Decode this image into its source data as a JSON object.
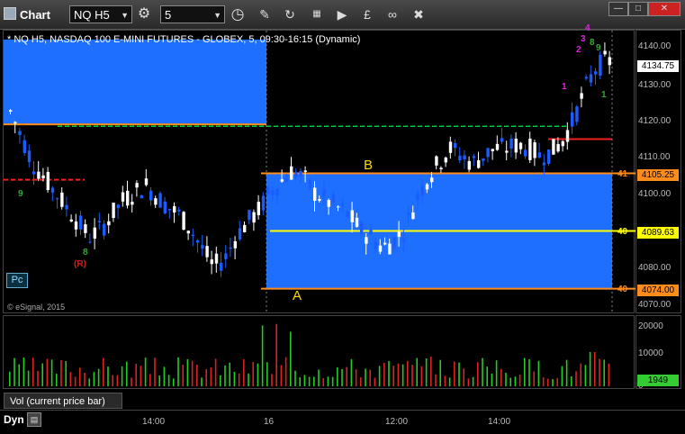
{
  "app": {
    "title": "Chart"
  },
  "toolbar": {
    "symbol": "NQ H5",
    "interval": "5"
  },
  "chart": {
    "header": "* NQ H5, NASDAQ 100 E-MINI FUTURES - GLOBEX, 5, 09:30-16:15 (Dynamic)",
    "watermark": "© eSignal, 2015",
    "pc_label": "Pc",
    "annotations": {
      "a": "A",
      "b": "B"
    },
    "price_ticks": [
      "4140.00",
      "4130.00",
      "4120.00",
      "4110.00",
      "4100.00",
      "4080.00",
      "4070.00"
    ],
    "levels": [
      {
        "value": "4105.25",
        "stub": "41",
        "color": "#ff8c1a"
      },
      {
        "value": "4089.63",
        "stub": "40",
        "color": "#ffff00"
      },
      {
        "value": "4074.00",
        "stub": "40",
        "color": "#ff8c1a"
      }
    ],
    "current_price": "4134.75",
    "volume_ticks": [
      "20000",
      "10000",
      "0"
    ],
    "current_volume": "1949",
    "volume_label": "Vol (current price bar)",
    "time_ticks": [
      "14:00",
      "16",
      "12:00",
      "14:00"
    ],
    "dyn_label": "Dyn",
    "count_labels": [
      "1",
      "2",
      "3",
      "4",
      "5",
      "8",
      "9",
      "1",
      "1",
      "2",
      "3",
      "9",
      "8",
      "9",
      "(R)",
      "1",
      "2",
      "3"
    ],
    "colors": {
      "up": "#ffffff",
      "down": "#1a5cff",
      "zone": "#1f6fff",
      "orange": "#ff8c1a",
      "yellow": "#ffff00",
      "green": "#00cc44",
      "magenta": "#e020e0"
    }
  }
}
